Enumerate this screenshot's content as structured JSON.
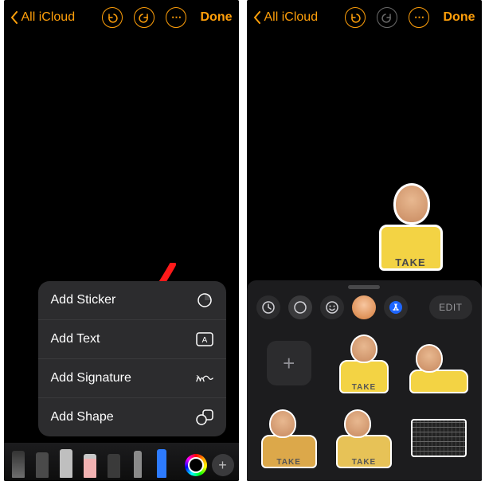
{
  "left": {
    "topbar": {
      "back_label": "All iCloud",
      "done_label": "Done"
    },
    "context_menu": {
      "items": [
        {
          "label": "Add Sticker",
          "icon": "sticker-icon"
        },
        {
          "label": "Add Text",
          "icon": "textbox-icon"
        },
        {
          "label": "Add Signature",
          "icon": "signature-icon"
        },
        {
          "label": "Add Shape",
          "icon": "shapes-icon"
        }
      ]
    },
    "tools": [
      {
        "name": "pen-tool",
        "color": "#6e6e6e"
      },
      {
        "name": "marker-tool",
        "color": "#4a4a4a"
      },
      {
        "name": "pencil-tool",
        "color": "#bfbfbf"
      },
      {
        "name": "eraser-tool",
        "color": "#f2b2b2"
      },
      {
        "name": "lasso-tool",
        "color": "#3a3a3a"
      },
      {
        "name": "ruler-tool",
        "color": "#8a8a8a"
      },
      {
        "name": "highlighter-tool",
        "color": "#2d7bff"
      }
    ]
  },
  "right": {
    "topbar": {
      "back_label": "All iCloud",
      "done_label": "Done"
    },
    "shirt_text": "TAKE",
    "picker": {
      "edit_label": "EDIT",
      "tabs": [
        {
          "name": "recents-tab",
          "icon": "clock-icon"
        },
        {
          "name": "stickers-tab",
          "icon": "sticker-icon"
        },
        {
          "name": "emoji-tab",
          "icon": "smiley-icon"
        },
        {
          "name": "memoji-tab",
          "icon": "memoji-icon"
        },
        {
          "name": "appstore-tab",
          "icon": "appstore-icon"
        }
      ]
    }
  }
}
